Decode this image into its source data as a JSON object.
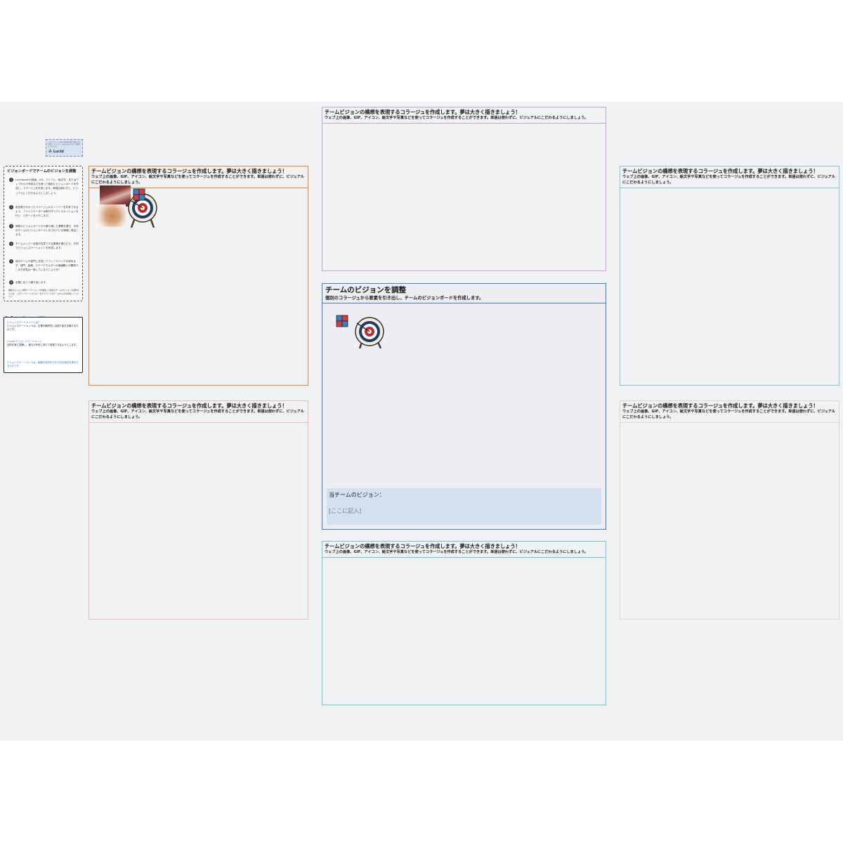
{
  "logo": {
    "text": "⁂ Lucid",
    "caption": "このテンプレートはLucidspark用に作成されています。テンプレートをカスタマイズして使用してください。"
  },
  "instructions": {
    "title": "ビジョンボードでチームのビジョンを調整",
    "steps": [
      {
        "num": "1",
        "text": "Lucidsparkの描画、GIF、アイコン・絵文字、またはウェブからの写真などを使って個別にビジョンボードを作成し、コラージュを作成します。単語は使わずに、ビジュアルにこだわるようにしましょう。"
      },
      {
        "num": "2",
        "text": "各自書きかかったコラージュのストーリーを共有できるよう、ファシリテーターは数分ずつディスカッションを行い、パターンをメモします。"
      },
      {
        "num": "3",
        "text": "個別のビジョンボードから最も適した要素を選び、中央のチームのビジョンボードに示されている領域に追加します。"
      },
      {
        "num": "4",
        "text": "チームメンバー全員が合意できる要素を選んだら、共同でビジョンステートメントを作成します。"
      },
      {
        "num": "5",
        "text": "他のチームや部門と共有してフィードバックを求めます。部門、組織、ステークホルダーの価値観との関係でこの方向性は一致しているでしょうか？"
      },
      {
        "num": "6",
        "text": "必要に応じて繰り返します。"
      }
    ],
    "note": "複数のビジョン調整ワークショップを開催した場合はチームのビジョンを調整するため、このテンプレートのコピーはアクティブなチームのものを使用してください。"
  },
  "resources": {
    "tag": "リソース",
    "items": [
      {
        "link": "ビジョンステートメントとは？",
        "text": "ビジョンステートメントは、企業が最終的に目指す姿を定義するものです。"
      },
      {
        "link": "Lucidのビジョンステートメント",
        "text": "目的を常に意識し、誰もが未来に向けて前進できるようにします。"
      },
      {
        "link": "ビジョンステートメントは、組織の目的を示す大切な指針を提示するものです。",
        "text": ""
      }
    ]
  },
  "collage_panel": {
    "title": "チームビジョンの構想を表現するコラージュを作成します。夢は大きく描きましょう！",
    "desc": "ウェブ上の画像、GIF、アイコン、絵文字や写真などを使ってコラージュを作成することができます。単語は使わずに、ビジュアルにこだわるようにしましょう。"
  },
  "center_panel": {
    "title": "チームのビジョンを調整",
    "subtitle": "個別のコラージュから要素を引き出し、チームのビジョンボードを作成します。",
    "vision_label": "当チームのビジョン：",
    "vision_placeholder": "[ここに記入]"
  },
  "colors": {
    "canvas": "#f1f2f4",
    "orange": "#e8812f",
    "purple": "#c9a3d6",
    "teal": "#7fcdc8",
    "pink": "#f1b8c2",
    "green": "#d3dcc4",
    "cyan": "#6cc4d7",
    "center": "#3f7fcf",
    "vision_box": "#d3e0f0"
  }
}
